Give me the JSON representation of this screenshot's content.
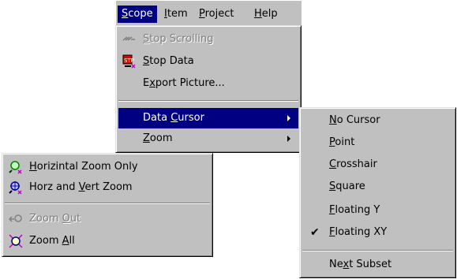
{
  "menubar": {
    "items": [
      {
        "pre": "",
        "key": "S",
        "post": "cope"
      },
      {
        "pre": "",
        "key": "I",
        "post": "tem"
      },
      {
        "pre": "",
        "key": "P",
        "post": "roject"
      },
      {
        "pre": "",
        "key": "H",
        "post": "elp"
      }
    ]
  },
  "scope_menu": {
    "items": [
      {
        "pre": "",
        "key": "S",
        "post": "top Scrolling",
        "icon": "stop-scrolling-icon",
        "enabled": false
      },
      {
        "pre": "",
        "key": "S",
        "post": "top Data",
        "icon": "stop-data-icon",
        "enabled": true
      },
      {
        "pre": "E",
        "key": "x",
        "post": "port Picture...",
        "icon": "",
        "enabled": true
      },
      {
        "pre": "Data ",
        "key": "C",
        "post": "ursor",
        "submenu": true,
        "highlighted": true
      },
      {
        "pre": "",
        "key": "Z",
        "post": "oom",
        "submenu": true
      }
    ]
  },
  "cursor_menu": {
    "items": [
      {
        "pre": "",
        "key": "N",
        "post": "o Cursor"
      },
      {
        "pre": "",
        "key": "P",
        "post": "oint"
      },
      {
        "pre": "",
        "key": "C",
        "post": "rosshair"
      },
      {
        "pre": "",
        "key": "S",
        "post": "quare"
      },
      {
        "pre": "",
        "key": "F",
        "post": "loating Y"
      },
      {
        "pre": "",
        "key": "F",
        "post": "loating XY",
        "checked": true
      },
      {
        "pre": "Ne",
        "key": "x",
        "post": "t Subset"
      }
    ],
    "check_glyph": "✔"
  },
  "zoom_menu": {
    "items": [
      {
        "pre": "",
        "key": "H",
        "post": "orizintal Zoom Only",
        "icon": "horizontal-zoom-icon",
        "enabled": true
      },
      {
        "pre": "Horz and ",
        "key": "V",
        "post": "ert Zoom",
        "icon": "horz-vert-zoom-icon",
        "enabled": true
      },
      {
        "pre": "Zoom ",
        "key": "O",
        "post": "ut",
        "icon": "zoom-out-icon",
        "enabled": false
      },
      {
        "pre": "Zoom ",
        "key": "A",
        "post": "ll",
        "icon": "zoom-all-icon",
        "enabled": true
      }
    ]
  },
  "colors": {
    "menu_bg": "#c0c0c0",
    "highlight": "#000080",
    "disabled": "#808080"
  }
}
